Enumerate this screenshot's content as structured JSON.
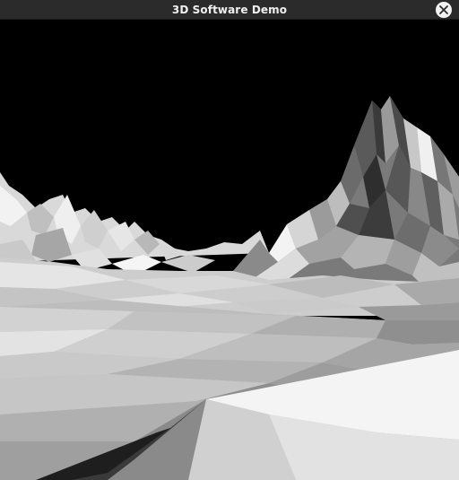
{
  "window": {
    "title": "3D Software Demo",
    "close_icon": "close-icon"
  },
  "viewport": {
    "scene": "terrain"
  },
  "colors": {
    "titlebar_bg": "#2b2b2b",
    "title_text": "#f0f0f0",
    "sky": "#000000"
  }
}
